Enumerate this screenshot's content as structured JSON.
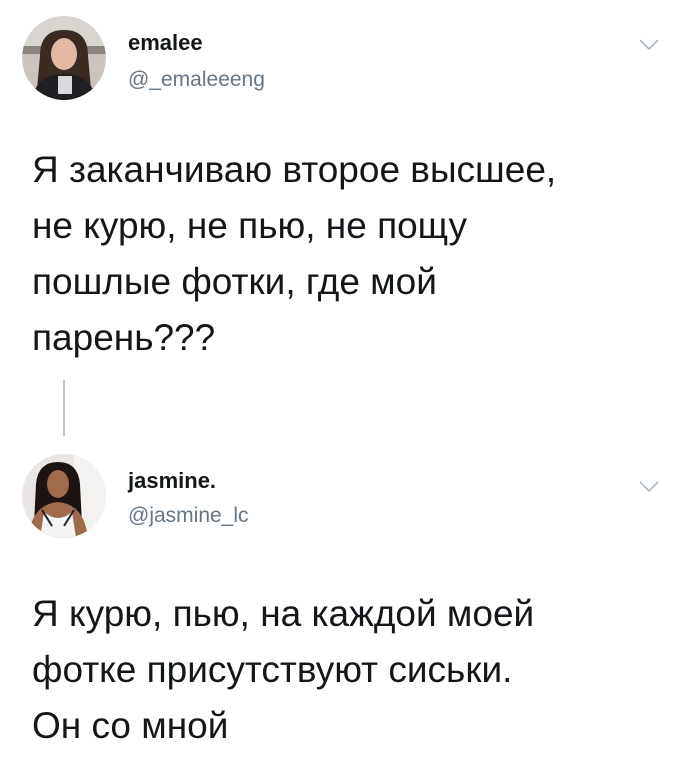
{
  "tweets": [
    {
      "display_name": "emalee",
      "handle": "@_emaleeeng",
      "text": "Я заканчиваю второе высшее,\nне курю, не пью, не пощу\nпошлые фотки, где мой\nпарень???",
      "avatar_icon": "profile-photo",
      "menu_icon": "chevron-down-icon"
    },
    {
      "display_name": "jasmine.",
      "handle": "@jasmine_lc",
      "text": "Я курю, пью, на каждой моей\nфотке присутствуют сиськи.\nОн со мной",
      "avatar_icon": "profile-photo",
      "menu_icon": "chevron-down-icon"
    }
  ],
  "colors": {
    "text": "#14171a",
    "secondary": "#657786",
    "thread_line": "#bdc6cf"
  }
}
